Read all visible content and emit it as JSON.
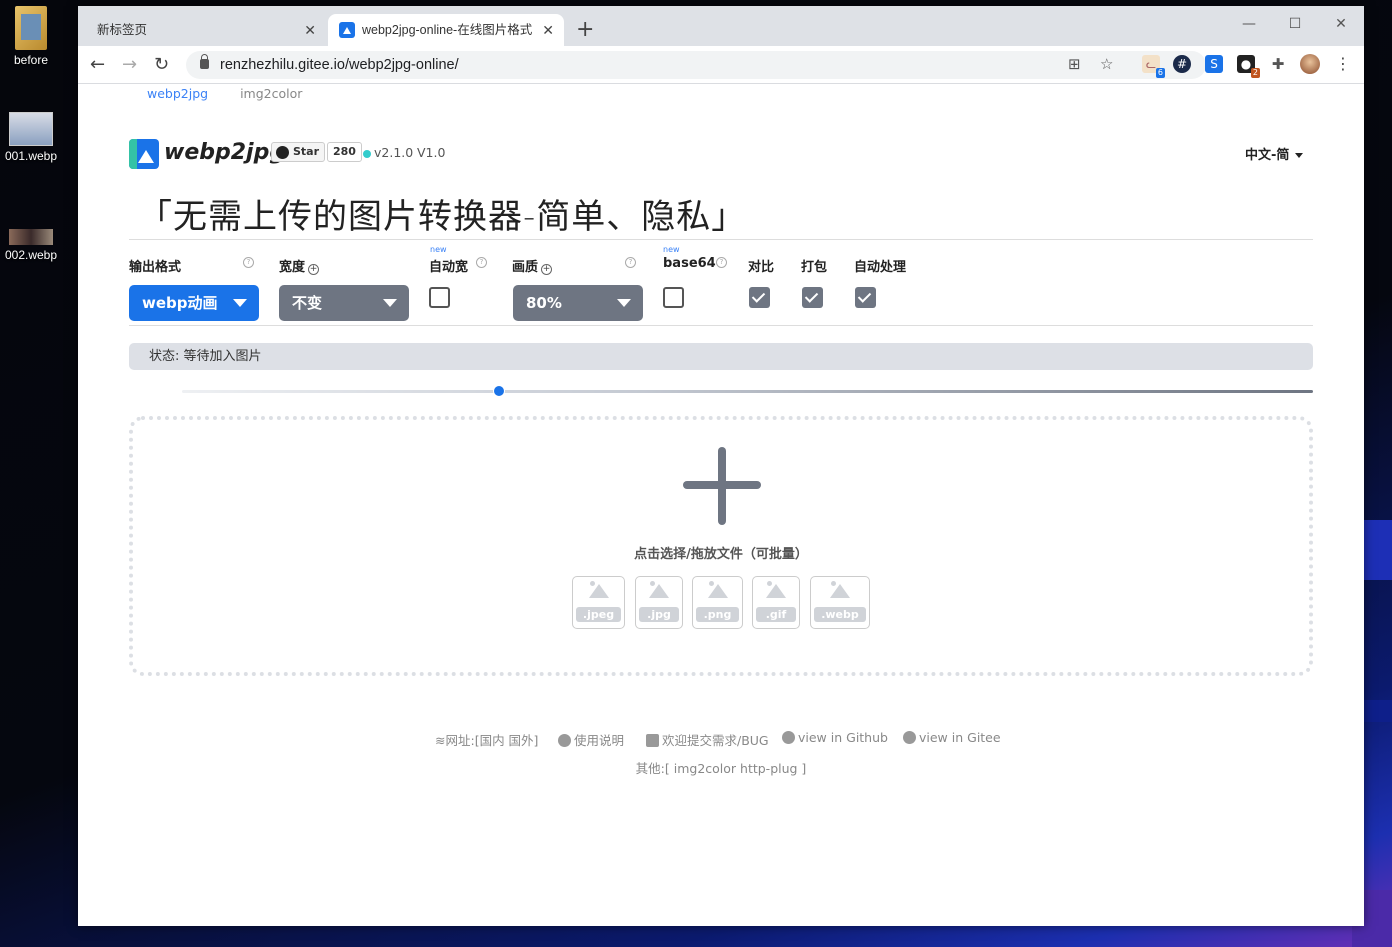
{
  "desktop": {
    "icons": [
      {
        "label": "before"
      },
      {
        "label": "001.webp"
      },
      {
        "label": "002.webp"
      }
    ]
  },
  "browser": {
    "tabs": [
      {
        "title": "新标签页"
      },
      {
        "title": "webp2jpg-online-在线图片格式"
      }
    ],
    "url": "renzhezhilu.gitee.io/webp2jpg-online/",
    "extensions": [
      {
        "name": "cat-extension-icon",
        "badge": "6"
      },
      {
        "name": "hash-extension-icon"
      },
      {
        "name": "s-extension-icon"
      },
      {
        "name": "dark-extension-icon",
        "badge": "2"
      },
      {
        "name": "puzzle-icon"
      },
      {
        "name": "profile-avatar"
      }
    ]
  },
  "page": {
    "subnav": [
      "webp2jpg",
      "img2color"
    ],
    "logo_text": "webp2jpg",
    "github": {
      "star_label": "Star",
      "count": "280"
    },
    "version": "v2.1.0",
    "version2": "V1.0",
    "language": "中文-简",
    "slogan": "「无需上传的图片转换器-简单、隐私」",
    "options": {
      "output_format": {
        "label": "输出格式",
        "value": "webp动画"
      },
      "width": {
        "label": "宽度",
        "value": "不变"
      },
      "auto_width": {
        "label": "自动宽",
        "new": "new",
        "checked": false
      },
      "quality": {
        "label": "画质",
        "value": "80%"
      },
      "base64": {
        "label": "base64",
        "new": "new",
        "checked": false
      },
      "compare": {
        "label": "对比",
        "checked": true
      },
      "pack": {
        "label": "打包",
        "checked": true
      },
      "auto_process": {
        "label": "自动处理",
        "checked": true
      }
    },
    "status": "状态: 等待加入图片",
    "slider_value": 0.28,
    "drop": {
      "text": "点击选择/拖放文件（可批量）",
      "types": [
        ".jpeg",
        ".jpg",
        ".png",
        ".gif",
        ".webp"
      ]
    },
    "footer": {
      "site": "网址:[国内 国外]",
      "manual": "使用说明",
      "feedback": "欢迎提交需求/BUG",
      "github": "view in Github",
      "gitee": "view in Gitee",
      "others": "其他:[  img2color   http-plug ]"
    }
  },
  "colors": {
    "primary": "#1a73e8",
    "select_gray": "#6e7582"
  }
}
